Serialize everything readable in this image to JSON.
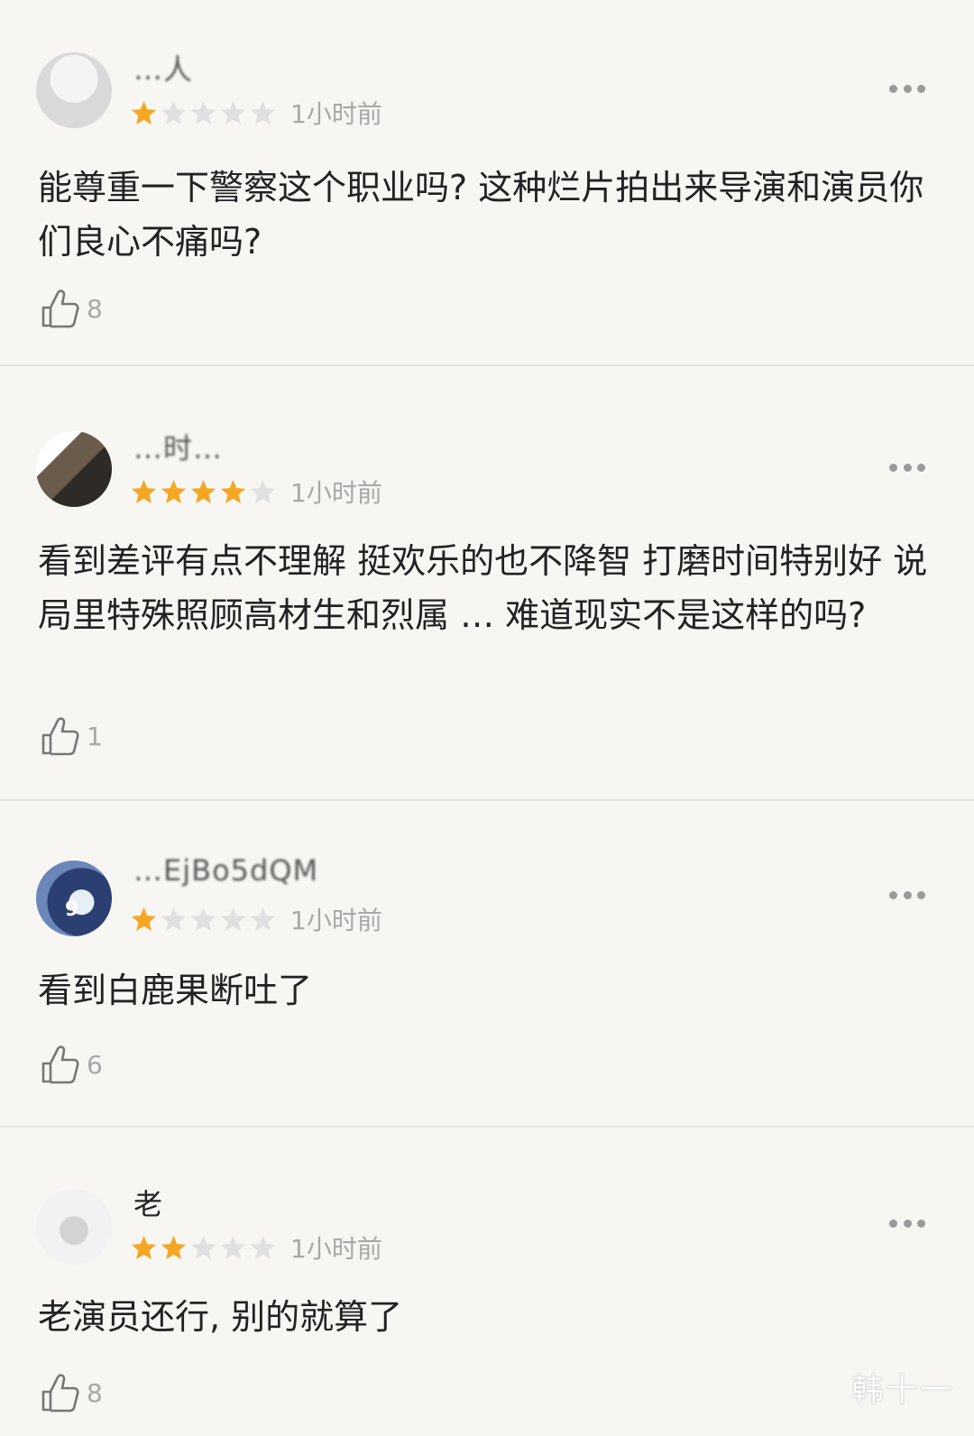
{
  "colors": {
    "star_on": "#f5a623",
    "star_off": "#e0e0e0",
    "meta_gray": "#a8a8a8"
  },
  "reviews": [
    {
      "username": "…人",
      "rating": 1,
      "time": "1小时前",
      "content": "能尊重一下警察这个职业吗? 这种烂片拍出来导演和演员你们良心不痛吗?",
      "likes": "8"
    },
    {
      "username": "…时…",
      "rating": 4,
      "time": "1小时前",
      "content": "看到差评有点不理解 挺欢乐的也不降智 打磨时间特别好 说局里特殊照顾高材生和烈属 … 难道现实不是这样的吗?",
      "likes": "1"
    },
    {
      "username": "…EjBo5dQM",
      "rating": 1,
      "time": "1小时前",
      "content": "看到白鹿果断吐了",
      "likes": "6"
    },
    {
      "username": "老",
      "rating": 2,
      "time": "1小时前",
      "content": "老演员还行, 别的就算了",
      "likes": "8"
    }
  ],
  "watermark": "韩十一"
}
